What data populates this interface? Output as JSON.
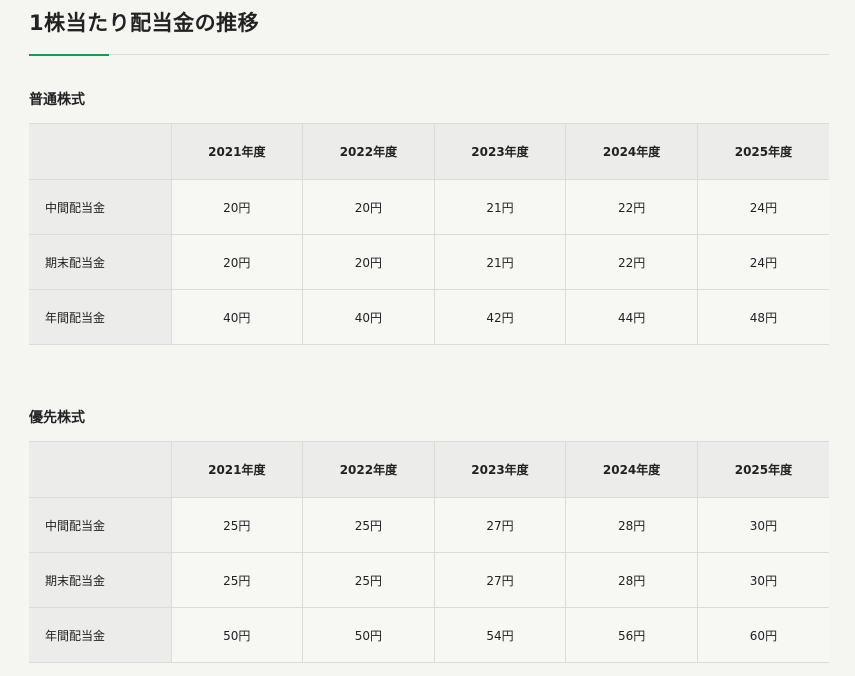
{
  "page_title": "1株当たり配当金の推移",
  "colors": {
    "accent": "#1a9a4a",
    "header_bg": "#ececea",
    "page_bg": "#f5f5f1",
    "border": "#dcdcd6"
  },
  "sections": [
    {
      "heading": "普通株式",
      "columns": [
        "",
        "2021年度",
        "2022年度",
        "2023年度",
        "2024年度",
        "2025年度"
      ],
      "rows": [
        {
          "label": "中間配当金",
          "values": [
            "20円",
            "20円",
            "21円",
            "22円",
            "24円"
          ]
        },
        {
          "label": "期末配当金",
          "values": [
            "20円",
            "20円",
            "21円",
            "22円",
            "24円"
          ]
        },
        {
          "label": "年間配当金",
          "values": [
            "40円",
            "40円",
            "42円",
            "44円",
            "48円"
          ]
        }
      ]
    },
    {
      "heading": "優先株式",
      "columns": [
        "",
        "2021年度",
        "2022年度",
        "2023年度",
        "2024年度",
        "2025年度"
      ],
      "rows": [
        {
          "label": "中間配当金",
          "values": [
            "25円",
            "25円",
            "27円",
            "28円",
            "30円"
          ]
        },
        {
          "label": "期末配当金",
          "values": [
            "25円",
            "25円",
            "27円",
            "28円",
            "30円"
          ]
        },
        {
          "label": "年間配当金",
          "values": [
            "50円",
            "50円",
            "54円",
            "56円",
            "60円"
          ]
        }
      ]
    }
  ]
}
